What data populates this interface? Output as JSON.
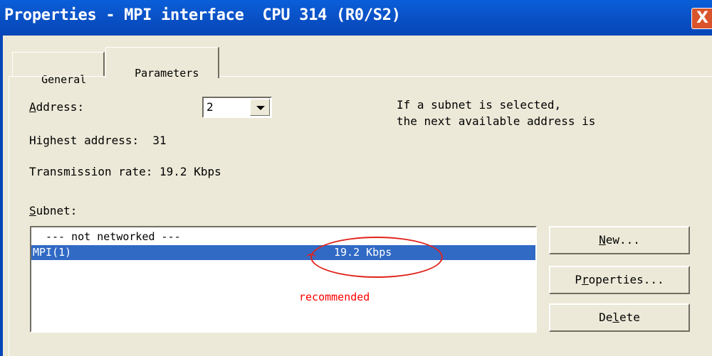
{
  "window": {
    "title": "Properties - MPI interface  CPU 314 (R0/S2)",
    "close_glyph": "X"
  },
  "tabs": [
    {
      "label": "General"
    },
    {
      "label": "Parameters"
    }
  ],
  "address": {
    "label_prefix": "",
    "label_mnemonic": "A",
    "label_rest": "ddress:",
    "value": "2"
  },
  "highest_address": "Highest address:  31",
  "transmission_rate": "Transmission rate: 19.2 Kbps",
  "hint": {
    "line1": "If a subnet is selected,",
    "line2": "the next available address is"
  },
  "subnet": {
    "label_mnemonic": "S",
    "label_rest": "ubnet:",
    "rows": [
      {
        "name": "--- not networked ---",
        "rate": ""
      },
      {
        "name": "MPI(1)",
        "rate": "19.2 Kbps"
      }
    ]
  },
  "annotation": {
    "text": "recommended",
    "color": "#ff0000"
  },
  "buttons": {
    "new_mnemonic": "N",
    "new_rest": "ew...",
    "props_pre": "P",
    "props_mnemonic": "r",
    "props_rest": "operties...",
    "delete_pre": "De",
    "delete_mnemonic": "l",
    "delete_rest": "ete"
  },
  "colors": {
    "title_bar": "#0a52c8",
    "selection": "#316ac5",
    "dialog_bg": "#ece9d8"
  }
}
